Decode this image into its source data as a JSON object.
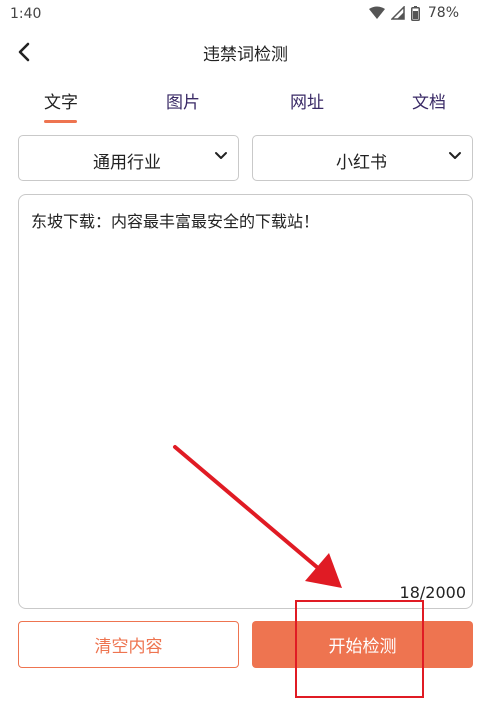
{
  "status_bar": {
    "time": "1:40",
    "battery": "78%"
  },
  "app_bar": {
    "title": "违禁词检测"
  },
  "tabs": [
    {
      "label": "文字",
      "active": true
    },
    {
      "label": "图片",
      "active": false
    },
    {
      "label": "网址",
      "active": false
    },
    {
      "label": "文档",
      "active": false
    }
  ],
  "filters": {
    "industry": "通用行业",
    "platform": "小红书"
  },
  "editor": {
    "text": "东坡下载：内容最丰富最安全的下载站！",
    "counter": "18/2000"
  },
  "actions": {
    "clear_label": "清空内容",
    "start_label": "开始检测"
  },
  "colors": {
    "accent": "#ee7450",
    "annotation": "#e01b24",
    "tab_inactive": "#3a2a66"
  }
}
